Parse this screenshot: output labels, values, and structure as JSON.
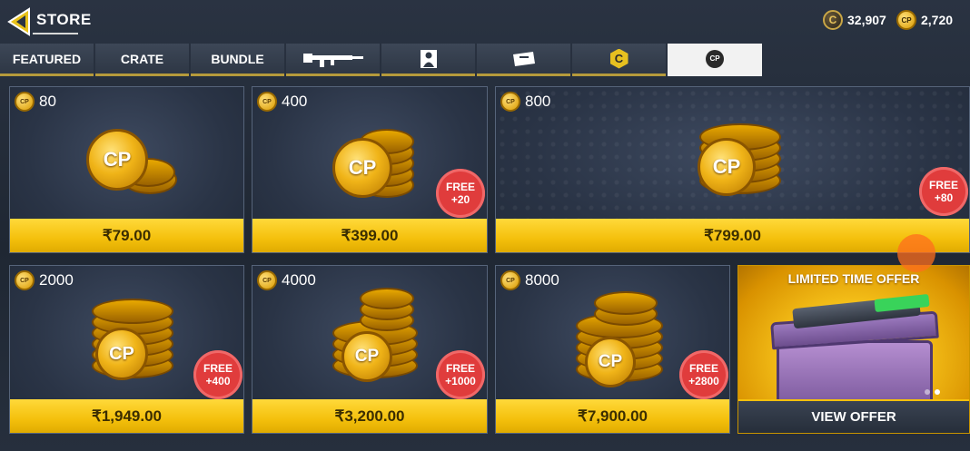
{
  "header": {
    "title": "STORE",
    "currency_c": "32,907",
    "currency_cp": "2,720",
    "c_icon_letter": "C",
    "cp_icon_label": "CP"
  },
  "tabs": [
    {
      "label": "FEATURED",
      "icon": null
    },
    {
      "label": "CRATE",
      "icon": null
    },
    {
      "label": "BUNDLE",
      "icon": null
    },
    {
      "label": "",
      "icon": "weapon-icon"
    },
    {
      "label": "",
      "icon": "character-icon"
    },
    {
      "label": "",
      "icon": "ticket-icon"
    },
    {
      "label": "",
      "icon": "c-currency-icon"
    },
    {
      "label": "",
      "icon": "cp-currency-icon",
      "active": true
    }
  ],
  "tab_icon_text": {
    "c": "C",
    "cp": "CP"
  },
  "cards": [
    {
      "amount": "80",
      "price": "₹79.00",
      "free": null
    },
    {
      "amount": "400",
      "price": "₹399.00",
      "free": "+20"
    },
    {
      "amount": "800",
      "price": "₹799.00",
      "free": "+80"
    },
    {
      "amount": "2000",
      "price": "₹1,949.00",
      "free": "+400"
    },
    {
      "amount": "4000",
      "price": "₹3,200.00",
      "free": "+1000"
    },
    {
      "amount": "8000",
      "price": "₹7,900.00",
      "free": "+2800"
    }
  ],
  "free_label": "FREE",
  "coin_label": "CP",
  "offer": {
    "title": "LIMITED TIME OFFER",
    "button": "VIEW OFFER"
  },
  "colors": {
    "accent_gold": "#f4c00c",
    "badge_red": "#e03c3c",
    "bg_dark": "#222b3a"
  }
}
